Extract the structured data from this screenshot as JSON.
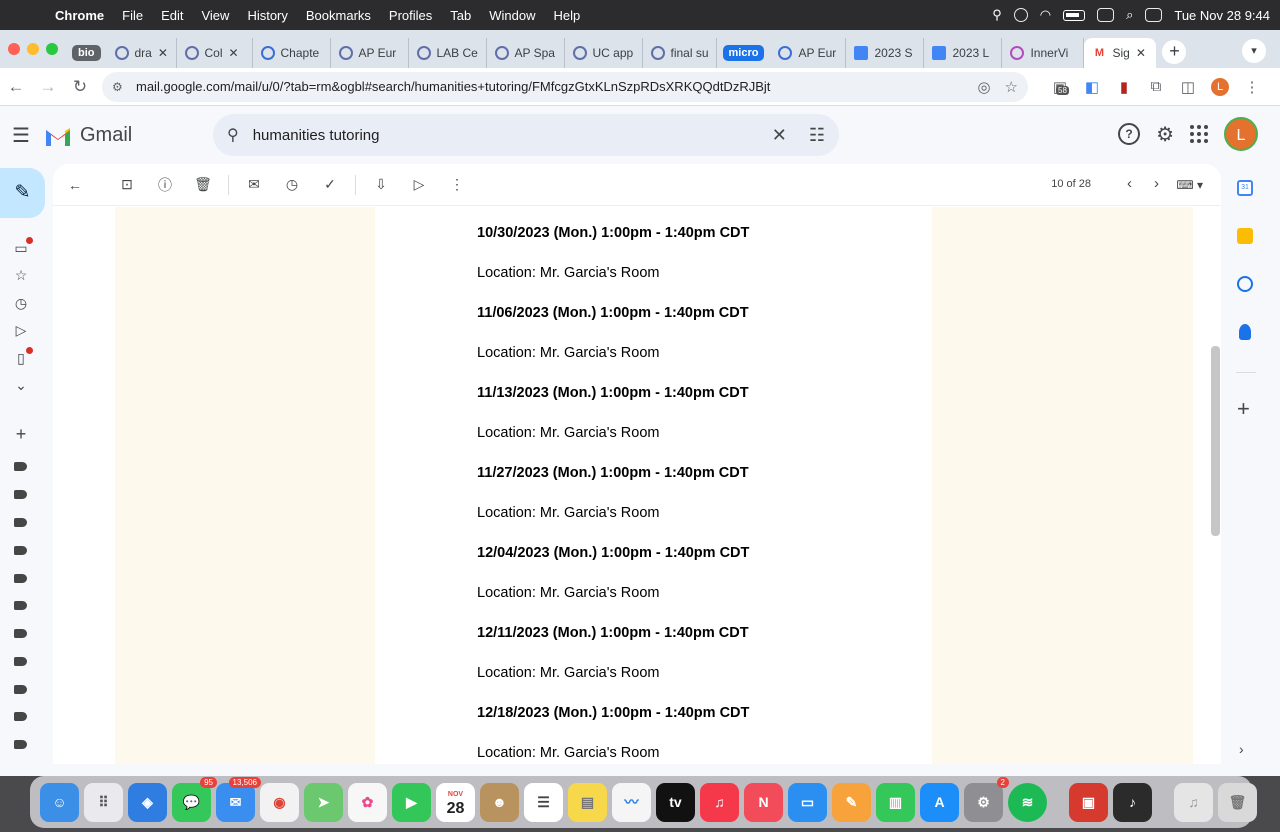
{
  "menubar": {
    "app_name": "Chrome",
    "items": [
      "File",
      "Edit",
      "View",
      "History",
      "Bookmarks",
      "Profiles",
      "Tab",
      "Window",
      "Help"
    ],
    "datetime": "Tue Nov 28  9:44"
  },
  "browser": {
    "tabs": [
      {
        "group": "bio",
        "group_color": "#5f6368",
        "label": "dra",
        "icon": "globe-icon"
      },
      {
        "label": "Col",
        "icon": "globe-icon"
      },
      {
        "label": "Chapte",
        "icon": "quizlet-icon"
      },
      {
        "label": "AP Eur",
        "icon": "globe-icon"
      },
      {
        "label": "LAB Ce",
        "icon": "globe-icon"
      },
      {
        "label": "AP Spa",
        "icon": "globe-icon"
      },
      {
        "label": "UC app",
        "icon": "globe-icon"
      },
      {
        "label": "final su",
        "icon": "globe-icon"
      },
      {
        "group": "micro",
        "group_color": "#1a73e8",
        "label": "AP Eur",
        "icon": "quizlet-icon"
      },
      {
        "label": "2023 S",
        "icon": "docs-icon"
      },
      {
        "label": "2023 L",
        "icon": "docs-icon"
      },
      {
        "label": "InnerVi",
        "icon": "innervision-icon"
      },
      {
        "label": "Sig",
        "icon": "gmail-icon",
        "active": true
      }
    ],
    "url": "mail.google.com/mail/u/0/?tab=rm&ogbl#search/humanities+tutoring/FMfcgzGtxKLnSzpRDsXRKQQdtDzRJBjt",
    "extension_badge": "58",
    "profile_initial": "L"
  },
  "gmail": {
    "logo_text": "Gmail",
    "search_query": "humanities tutoring",
    "avatar_initial": "L",
    "pager": "10 of 28",
    "sessions": [
      {
        "date": "10/30/2023 (Mon.) 1:00pm - 1:40pm CDT",
        "location": "Location: Mr. Garcia's Room"
      },
      {
        "date": "11/06/2023 (Mon.) 1:00pm - 1:40pm CDT",
        "location": "Location: Mr. Garcia's Room"
      },
      {
        "date": "11/13/2023 (Mon.) 1:00pm - 1:40pm CDT",
        "location": "Location: Mr. Garcia's Room"
      },
      {
        "date": "11/27/2023 (Mon.) 1:00pm - 1:40pm CDT",
        "location": "Location: Mr. Garcia's Room"
      },
      {
        "date": "12/04/2023 (Mon.) 1:00pm - 1:40pm CDT",
        "location": "Location: Mr. Garcia's Room"
      },
      {
        "date": "12/11/2023 (Mon.) 1:00pm - 1:40pm CDT",
        "location": "Location: Mr. Garcia's Room"
      },
      {
        "date": "12/18/2023 (Mon.) 1:00pm - 1:40pm CDT",
        "location": "Location: Mr. Garcia's Room"
      }
    ]
  },
  "dock": {
    "apps": [
      {
        "name": "finder-icon",
        "color": "#3b8fe6"
      },
      {
        "name": "launchpad-icon",
        "color": "#e9e9ee"
      },
      {
        "name": "safari-icon",
        "color": "#2f7de1"
      },
      {
        "name": "messages-icon",
        "color": "#34c759",
        "badge": "95"
      },
      {
        "name": "mail-icon",
        "color": "#3a8ef0",
        "badge": "13,506"
      },
      {
        "name": "chrome-icon",
        "color": "#f2f2f2"
      },
      {
        "name": "maps-icon",
        "color": "#6cc86f"
      },
      {
        "name": "photos-icon",
        "color": "#f7f7f7"
      },
      {
        "name": "facetime-icon",
        "color": "#33c759"
      },
      {
        "name": "calendar-icon",
        "color": "#ffffff",
        "label": "28",
        "sublabel": "NOV"
      },
      {
        "name": "contacts-icon",
        "color": "#b8935f"
      },
      {
        "name": "reminders-icon",
        "color": "#ffffff"
      },
      {
        "name": "notes-icon",
        "color": "#f7d84a"
      },
      {
        "name": "freeform-icon",
        "color": "#f5f5f5"
      },
      {
        "name": "tv-icon",
        "color": "#111111",
        "label": "tv"
      },
      {
        "name": "music-icon",
        "color": "#f5394b"
      },
      {
        "name": "news-icon",
        "color": "#f24c5a"
      },
      {
        "name": "keynote-icon",
        "color": "#2b8ff1"
      },
      {
        "name": "pages-icon",
        "color": "#f7a23b"
      },
      {
        "name": "numbers-icon",
        "color": "#34c759"
      },
      {
        "name": "app-store-icon",
        "color": "#1c8ef9"
      },
      {
        "name": "system-settings-icon",
        "color": "#8e8e93",
        "badge": "2"
      },
      {
        "name": "spotify-icon",
        "color": "#1db954"
      },
      {
        "name": "photo-booth-icon",
        "color": "#d63a2f"
      },
      {
        "name": "garageband-icon",
        "color": "#2b2b2b"
      },
      {
        "name": "music-folder-icon",
        "color": "#e5e5e5"
      },
      {
        "name": "trash-icon",
        "color": "#d9d9d9"
      }
    ]
  },
  "colors": {
    "compose_bg": "#c2e7ff",
    "email_side_bg": "#fdf9ec",
    "avatar": "#e4712d"
  }
}
